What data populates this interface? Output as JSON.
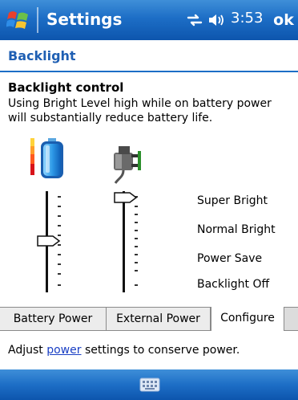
{
  "titlebar": {
    "title": "Settings",
    "clock": "3:53",
    "ok_label": "ok",
    "icons": [
      "windows-start-icon",
      "connectivity-icon",
      "volume-icon"
    ]
  },
  "page": {
    "title": "Backlight"
  },
  "backlight": {
    "heading": "Backlight control",
    "description": "Using Bright Level high while on battery power will substantially reduce battery life.",
    "sources": [
      {
        "name": "battery",
        "icon": "battery-icon",
        "level_fraction": 0.45
      },
      {
        "name": "external",
        "icon": "power-plug-icon",
        "level_fraction": 1.0
      }
    ],
    "level_labels": [
      "Super Bright",
      "Normal Bright",
      "Power Save",
      "Backlight Off"
    ]
  },
  "tabs": [
    {
      "label": "Battery Power",
      "selected": false
    },
    {
      "label": "External Power",
      "selected": false
    },
    {
      "label": "Configure",
      "selected": true
    }
  ],
  "footer": {
    "prefix": "Adjust ",
    "link_text": "power",
    "suffix": " settings to conserve power."
  },
  "menubar": {
    "icon": "keyboard-icon"
  },
  "colors": {
    "title_bar": "#1d6ec6",
    "page_title": "#1f5fb3",
    "link": "#1a3fc4",
    "tab_bg": "#ececec"
  }
}
